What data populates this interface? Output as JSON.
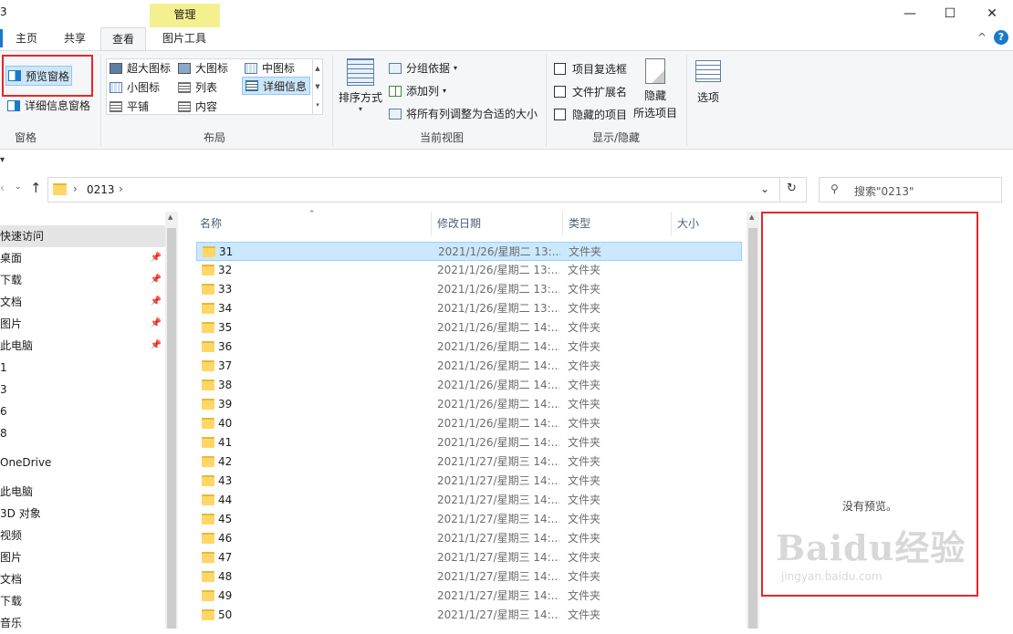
{
  "window": {
    "title_fragment": "3",
    "minimize_glyph": "—",
    "maximize_glyph": "☐",
    "close_glyph": "✕",
    "help_glyph": "?",
    "collapse_glyph": "^"
  },
  "tabs": {
    "home": "主页",
    "share": "共享",
    "view": "查看",
    "picture_tools": "图片工具",
    "manage": "管理"
  },
  "ribbon": {
    "panes": {
      "preview_pane": "预览窗格",
      "details_pane": "详细信息窗格",
      "label": "窗格"
    },
    "layout": {
      "extra_large": "超大图标",
      "large": "大图标",
      "medium": "中图标",
      "small": "小图标",
      "list": "列表",
      "details": "详细信息",
      "tiles": "平铺",
      "content": "内容",
      "label": "布局"
    },
    "current_view": {
      "sort_by": "排序方式",
      "group_by": "分组依据",
      "add_column": "添加列",
      "size_all_columns": "将所有列调整为合适的大小",
      "label": "当前视图"
    },
    "show_hide": {
      "item_checkboxes": "项目复选框",
      "file_extensions": "文件扩展名",
      "hidden_items": "隐藏的项目",
      "hide_selected_line1": "隐藏",
      "hide_selected_line2": "所选项目",
      "label": "显示/隐藏"
    },
    "options": "选项"
  },
  "address": {
    "path": "0213",
    "search_placeholder": "搜索\"0213\""
  },
  "nav": [
    {
      "label": "快速访问",
      "pinned": false
    },
    {
      "label": "桌面",
      "pinned": true
    },
    {
      "label": "下载",
      "pinned": true
    },
    {
      "label": "文档",
      "pinned": true
    },
    {
      "label": "图片",
      "pinned": true
    },
    {
      "label": "此电脑",
      "pinned": true
    },
    {
      "label": "1",
      "pinned": false
    },
    {
      "label": "3",
      "pinned": false
    },
    {
      "label": "6",
      "pinned": false
    },
    {
      "label": "8",
      "pinned": false
    },
    {
      "label": "OneDrive",
      "pinned": false
    },
    {
      "label": "此电脑",
      "pinned": false
    },
    {
      "label": "3D 对象",
      "pinned": false
    },
    {
      "label": "视频",
      "pinned": false
    },
    {
      "label": "图片",
      "pinned": false
    },
    {
      "label": "文档",
      "pinned": false
    },
    {
      "label": "下载",
      "pinned": false
    },
    {
      "label": "音乐",
      "pinned": false
    }
  ],
  "columns": {
    "name": "名称",
    "modified": "修改日期",
    "type": "类型",
    "size": "大小"
  },
  "files": [
    {
      "name": "31",
      "modified": "2021/1/26/星期二 13:...",
      "type": "文件夹",
      "selected": true
    },
    {
      "name": "32",
      "modified": "2021/1/26/星期二 13:...",
      "type": "文件夹"
    },
    {
      "name": "33",
      "modified": "2021/1/26/星期二 13:...",
      "type": "文件夹"
    },
    {
      "name": "34",
      "modified": "2021/1/26/星期二 13:...",
      "type": "文件夹"
    },
    {
      "name": "35",
      "modified": "2021/1/26/星期二 14:...",
      "type": "文件夹"
    },
    {
      "name": "36",
      "modified": "2021/1/26/星期二 14:...",
      "type": "文件夹"
    },
    {
      "name": "37",
      "modified": "2021/1/26/星期二 14:...",
      "type": "文件夹"
    },
    {
      "name": "38",
      "modified": "2021/1/26/星期二 14:...",
      "type": "文件夹"
    },
    {
      "name": "39",
      "modified": "2021/1/26/星期二 14:...",
      "type": "文件夹"
    },
    {
      "name": "40",
      "modified": "2021/1/26/星期二 14:...",
      "type": "文件夹"
    },
    {
      "name": "41",
      "modified": "2021/1/26/星期二 14:...",
      "type": "文件夹"
    },
    {
      "name": "42",
      "modified": "2021/1/27/星期三 14:...",
      "type": "文件夹"
    },
    {
      "name": "43",
      "modified": "2021/1/27/星期三 14:...",
      "type": "文件夹"
    },
    {
      "name": "44",
      "modified": "2021/1/27/星期三 14:...",
      "type": "文件夹"
    },
    {
      "name": "45",
      "modified": "2021/1/27/星期三 14:...",
      "type": "文件夹"
    },
    {
      "name": "46",
      "modified": "2021/1/27/星期三 14:...",
      "type": "文件夹"
    },
    {
      "name": "47",
      "modified": "2021/1/27/星期三 14:...",
      "type": "文件夹"
    },
    {
      "name": "48",
      "modified": "2021/1/27/星期三 14:...",
      "type": "文件夹"
    },
    {
      "name": "49",
      "modified": "2021/1/27/星期三 14:...",
      "type": "文件夹"
    },
    {
      "name": "50",
      "modified": "2021/1/27/星期三 14:...",
      "type": "文件夹"
    }
  ],
  "preview": {
    "empty_text": "没有预览。"
  },
  "watermark": {
    "brand": "Baidu经验",
    "url": "jingyan.baidu.com"
  },
  "colors": {
    "highlight_red": "#e6262a",
    "manage_tab": "#f5f08f",
    "selection": "#cce8ff",
    "folder": "#ffd766"
  }
}
